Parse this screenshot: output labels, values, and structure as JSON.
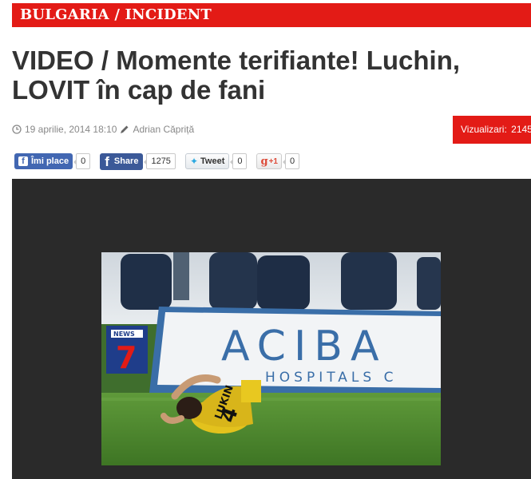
{
  "category": "BULGARIA / INCIDENT",
  "article": {
    "title": "VIDEO / Momente terifiante! Luchin, LOVIT în cap de fani",
    "date": "19 aprilie, 2014 18:10",
    "author": "Adrian Căpriță",
    "views_label": "Vizualizari:",
    "views_count": "2145"
  },
  "social": {
    "fb_like_label": "Îmi place",
    "fb_like_count": "0",
    "fb_share_label": "Share",
    "fb_share_count": "1275",
    "tweet_label": "Tweet",
    "tweet_count": "0",
    "gplus_count": "0"
  },
  "photo": {
    "banner_text": "ACIBA",
    "banner_subtext": "HOSPITALS C",
    "tv_logo_top": "NEWS",
    "tv_logo_num": "7",
    "jersey_name": "LUKIN",
    "jersey_number": "4"
  },
  "colors": {
    "accent_red": "#e31b16",
    "facebook_blue": "#3b5998",
    "video_bg": "#2a2a2a"
  }
}
